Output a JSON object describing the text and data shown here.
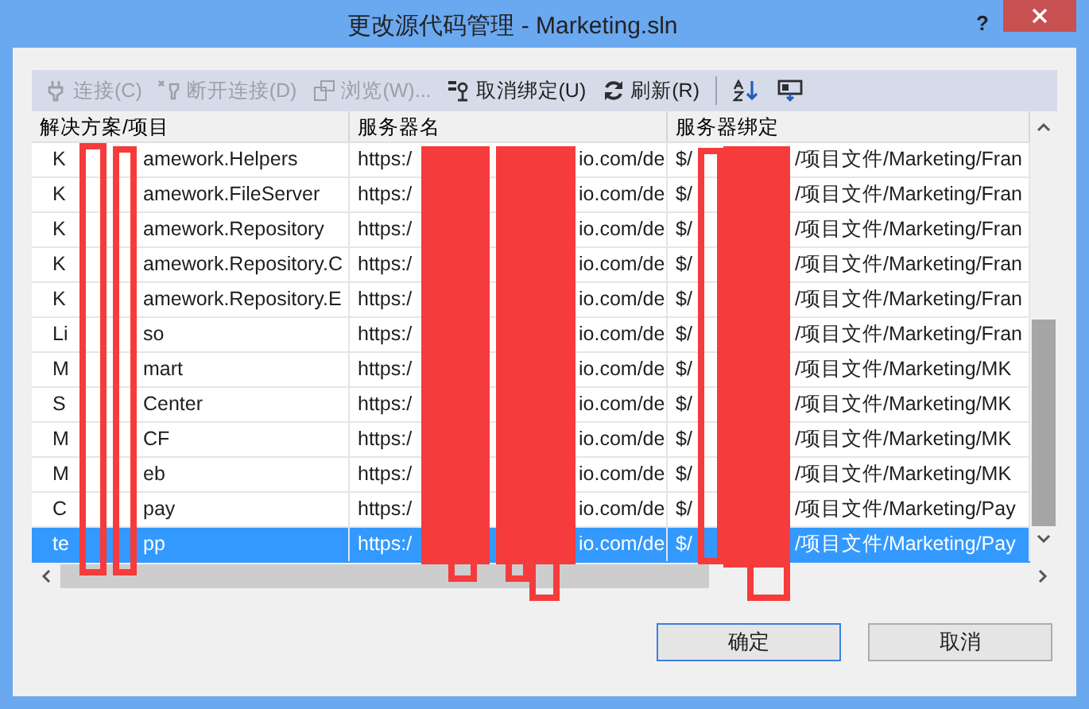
{
  "window": {
    "title": "更改源代码管理 - Marketing.sln",
    "help": "?"
  },
  "toolbar": [
    {
      "kind": "plug",
      "label": "连接(C)",
      "disabled": true
    },
    {
      "kind": "unplug",
      "label": "断开连接(D)",
      "disabled": true
    },
    {
      "kind": "browse",
      "label": "浏览(W)...",
      "disabled": true
    },
    {
      "kind": "unbind",
      "label": "取消绑定(U)",
      "disabled": false
    },
    {
      "kind": "refresh",
      "label": "刷新(R)",
      "disabled": false
    },
    {
      "kind": "sort",
      "disabled": false
    },
    {
      "kind": "properties",
      "disabled": false
    }
  ],
  "table": {
    "columns": [
      "解决方案/项目",
      "服务器名",
      "服务器绑定"
    ],
    "rows": [
      {
        "selected": false,
        "cells": [
          [
            "K",
            "amework.Helpers"
          ],
          [
            "https:/",
            "io.com/de"
          ],
          [
            "$/",
            "/项目文件/Marketing/Fran"
          ]
        ]
      },
      {
        "selected": false,
        "cells": [
          [
            "K",
            "amework.FileServer"
          ],
          [
            "https:/",
            "io.com/de"
          ],
          [
            "$/",
            "/项目文件/Marketing/Fran"
          ]
        ]
      },
      {
        "selected": false,
        "cells": [
          [
            "K",
            "amework.Repository"
          ],
          [
            "https:/",
            "io.com/de"
          ],
          [
            "$/",
            "/项目文件/Marketing/Fran"
          ]
        ]
      },
      {
        "selected": false,
        "cells": [
          [
            "K",
            "amework.Repository.C"
          ],
          [
            "https:/",
            "io.com/de"
          ],
          [
            "$/",
            "/项目文件/Marketing/Fran"
          ]
        ]
      },
      {
        "selected": false,
        "cells": [
          [
            "K",
            "amework.Repository.E"
          ],
          [
            "https:/",
            "io.com/de"
          ],
          [
            "$/",
            "/项目文件/Marketing/Fran"
          ]
        ]
      },
      {
        "selected": false,
        "cells": [
          [
            "Li",
            "so"
          ],
          [
            "https:/",
            "io.com/de"
          ],
          [
            "$/",
            "/项目文件/Marketing/Fran"
          ]
        ]
      },
      {
        "selected": false,
        "cells": [
          [
            "M",
            "mart"
          ],
          [
            "https:/",
            "io.com/de"
          ],
          [
            "$/",
            "/项目文件/Marketing/MK"
          ]
        ]
      },
      {
        "selected": false,
        "cells": [
          [
            "S",
            "Center"
          ],
          [
            "https:/",
            "io.com/de"
          ],
          [
            "$/",
            "/项目文件/Marketing/MK"
          ]
        ]
      },
      {
        "selected": false,
        "cells": [
          [
            "M",
            "CF"
          ],
          [
            "https:/",
            "io.com/de"
          ],
          [
            "$/",
            "/项目文件/Marketing/MK"
          ]
        ]
      },
      {
        "selected": false,
        "cells": [
          [
            "M",
            "eb"
          ],
          [
            "https:/",
            "io.com/de"
          ],
          [
            "$/",
            "/项目文件/Marketing/MK"
          ]
        ]
      },
      {
        "selected": false,
        "cells": [
          [
            "C",
            "pay"
          ],
          [
            "https:/",
            "io.com/de"
          ],
          [
            "$/",
            "/项目文件/Marketing/Pay"
          ]
        ]
      },
      {
        "selected": true,
        "cells": [
          [
            "te",
            "pp"
          ],
          [
            "https:/",
            "io.com/de"
          ],
          [
            "$/",
            "/项目文件/Marketing/Pay"
          ]
        ]
      }
    ]
  },
  "buttons": [
    {
      "label": "确定",
      "default": true
    },
    {
      "label": "取消",
      "default": false
    }
  ]
}
